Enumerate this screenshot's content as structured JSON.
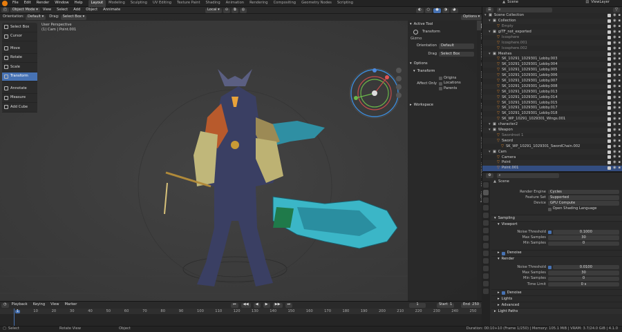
{
  "topbar": {
    "menus": [
      "File",
      "Edit",
      "Render",
      "Window",
      "Help"
    ],
    "workspaces": [
      "Layout",
      "Modeling",
      "Sculpting",
      "UV Editing",
      "Texture Paint",
      "Shading",
      "Animation",
      "Rendering",
      "Compositing",
      "Geometry Nodes",
      "Scripting"
    ],
    "scene": "Scene",
    "viewlayer": "ViewLayer"
  },
  "header": {
    "mode": "Object Mode",
    "menus": [
      "View",
      "Select",
      "Add",
      "Object",
      "Annimate"
    ],
    "transform": "Local"
  },
  "header2": {
    "orientation_label": "Orientation:",
    "orientation": "Default",
    "drag_label": "Drag:",
    "drag": "Select Box",
    "options": "Options"
  },
  "viewport": {
    "title": "User Perspective",
    "subtitle": "(1) Cam | Point.001"
  },
  "tools": [
    "Select Box",
    "Cursor",
    "Move",
    "Rotate",
    "Scale",
    "Transform",
    "Annotate",
    "Measure",
    "Add Cube"
  ],
  "npanel": {
    "active_tool": "Active Tool",
    "tool_name": "Transform",
    "gizmo": "Gizmo",
    "orientation_label": "Orientation",
    "orientation": "Default",
    "drag_label": "Drag",
    "drag": "Select Box",
    "options": "Options",
    "transform": "Transform",
    "affect_only": "Affect Only",
    "affect_items": [
      "Origins",
      "Locations",
      "Parents"
    ],
    "workspace": "Workspace"
  },
  "sidetabs": [
    "Tool",
    "View",
    "Animation",
    "AF",
    "Lead",
    "Blender/Kit",
    "Edit",
    "DAZ Runtime",
    "Genesis",
    "AFL",
    "Animation",
    "ARP",
    "Rigging"
  ],
  "outliner": {
    "rows": [
      {
        "label": "Scene Collection",
        "indent": 0
      },
      {
        "label": "Collection",
        "indent": 1
      },
      {
        "label": "Empty",
        "indent": 2
      },
      {
        "label": "glTF_not_exported",
        "indent": 1
      },
      {
        "label": "Icosphere",
        "indent": 2
      },
      {
        "label": "Icosphere.001",
        "indent": 2
      },
      {
        "label": "Icosphere.002",
        "indent": 2
      },
      {
        "label": "Meshes",
        "indent": 1
      },
      {
        "label": "SK_10291_1029301_Lobby.003",
        "indent": 2
      },
      {
        "label": "SK_10291_1029301_Lobby.004",
        "indent": 2
      },
      {
        "label": "SK_10291_1029301_Lobby.005",
        "indent": 2
      },
      {
        "label": "SK_10291_1029301_Lobby.006",
        "indent": 2
      },
      {
        "label": "SK_10291_1029301_Lobby.007",
        "indent": 2
      },
      {
        "label": "SK_10291_1029301_Lobby.008",
        "indent": 2
      },
      {
        "label": "SK_10291_1029301_Lobby.013",
        "indent": 2
      },
      {
        "label": "SK_10291_1029301_Lobby.014",
        "indent": 2
      },
      {
        "label": "SK_10291_1029301_Lobby.015",
        "indent": 2
      },
      {
        "label": "SK_10291_1029301_Lobby.017",
        "indent": 2
      },
      {
        "label": "SK_10291_1029301_Lobby.018",
        "indent": 2
      },
      {
        "label": "SK_WP_10291_1029301_Wings.001",
        "indent": 2
      },
      {
        "label": "character2",
        "indent": 1
      },
      {
        "label": "Weapon",
        "indent": 1
      },
      {
        "label": "Swordroot 1",
        "indent": 2
      },
      {
        "label": "Sword",
        "indent": 2
      },
      {
        "label": "SK_WP_10291_1029301_SwordChain.002",
        "indent": 3
      },
      {
        "label": "Cam",
        "indent": 1
      },
      {
        "label": "Camera",
        "indent": 2
      },
      {
        "label": "Point",
        "indent": 2
      },
      {
        "label": "Point.001",
        "indent": 2,
        "selected": true
      }
    ]
  },
  "props": {
    "scene": "Scene",
    "render_engine_label": "Render Engine",
    "render_engine": "Cycles",
    "feature_set_label": "Feature Set",
    "feature_set": "Supported",
    "device_label": "Device",
    "device": "GPU Compute",
    "osl": "Open Shading Language",
    "sampling": "Sampling",
    "viewport": "Viewport",
    "noise_threshold_label": "Noise Threshold",
    "vp_noise": "0.1000",
    "max_samples_label": "Max Samples",
    "vp_max": "30",
    "min_samples_label": "Min Samples",
    "vp_min": "0",
    "denoise": "Denoise",
    "render": "Render",
    "r_noise": "0.0100",
    "r_max": "30",
    "r_min": "0",
    "time_limit_label": "Time Limit",
    "r_time": "0 s",
    "denoise2": "Denoise",
    "lights": "Lights",
    "advanced": "Advanced",
    "light_paths": "Light Paths"
  },
  "timeline": {
    "menus": [
      "Playback",
      "Keying",
      "View",
      "Marker"
    ],
    "current": "1",
    "start_label": "Start",
    "start": "1",
    "end_label": "End",
    "end": "250",
    "ticks": [
      "1",
      "10",
      "20",
      "30",
      "40",
      "50",
      "60",
      "70",
      "80",
      "90",
      "100",
      "110",
      "120",
      "130",
      "140",
      "150",
      "160",
      "170",
      "180",
      "190",
      "200",
      "210",
      "220",
      "230",
      "240",
      "250"
    ]
  },
  "status": {
    "left": "Select",
    "mid": "Rotate View",
    "right": "Object",
    "info": "Duration: 00:10+10 (Frame 1/250) | Memory: 105.1 MiB | VRAM: 3.7/24.0 GiB | 4.1.0"
  }
}
